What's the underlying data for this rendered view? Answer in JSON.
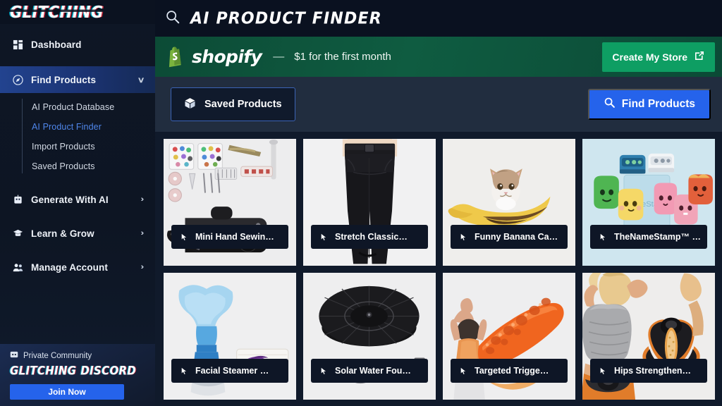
{
  "brand": {
    "logo_text": "GLITCHING"
  },
  "sidebar": {
    "items": [
      {
        "label": "Dashboard",
        "icon": "dashboard-icon",
        "chevron": "",
        "active": false
      },
      {
        "label": "Find Products",
        "icon": "compass-icon",
        "chevron": "∨",
        "active": true
      },
      {
        "label": "Generate With AI",
        "icon": "robot-icon",
        "chevron": "›",
        "active": false
      },
      {
        "label": "Learn & Grow",
        "icon": "graduation-icon",
        "chevron": "›",
        "active": false
      },
      {
        "label": "Manage Account",
        "icon": "people-icon",
        "chevron": "›",
        "active": false
      }
    ],
    "submenu": [
      {
        "label": "AI Product Database",
        "selected": false
      },
      {
        "label": "AI Product Finder",
        "selected": true
      },
      {
        "label": "Import Products",
        "selected": false
      },
      {
        "label": "Saved Products",
        "selected": false
      }
    ],
    "discord": {
      "eyebrow": "Private Community",
      "icon": "discord-icon",
      "title_part1": "GLITCHING",
      "title_part2": "DISCORD",
      "button_label": "Join Now"
    }
  },
  "header": {
    "icon": "search-icon",
    "title": "AI PRODUCT FINDER"
  },
  "promo": {
    "brand_icon": "shopify-bag-icon",
    "brand_name": "shopify",
    "separator": "—",
    "offer": "$1 for the first month",
    "cta_label": "Create My Store",
    "cta_icon": "external-link-icon",
    "bar_color": "#0f5c41",
    "cta_color": "#0e9e63"
  },
  "toolbar": {
    "saved_label": "Saved Products",
    "saved_icon": "package-icon",
    "find_label": "Find Products",
    "find_icon": "search-icon",
    "accent_color": "#2563eb"
  },
  "products": [
    {
      "title": "Mini Hand Sewin…",
      "icon": "cursor-click-icon",
      "art": "sewing"
    },
    {
      "title": "Stretch Classic…",
      "icon": "cursor-click-icon",
      "art": "pants"
    },
    {
      "title": "Funny Banana Ca…",
      "icon": "cursor-click-icon",
      "art": "banana"
    },
    {
      "title": "TheNameStamp™ …",
      "icon": "cursor-click-icon",
      "art": "stamps"
    },
    {
      "title": "Facial Steamer …",
      "icon": "cursor-click-icon",
      "art": "steamer"
    },
    {
      "title": "Solar Water Fou…",
      "icon": "cursor-click-icon",
      "art": "fountain"
    },
    {
      "title": "Targeted Trigge…",
      "icon": "cursor-click-icon",
      "art": "trigger"
    },
    {
      "title": "Hips Strengthen…",
      "icon": "cursor-click-icon",
      "art": "hips"
    }
  ]
}
